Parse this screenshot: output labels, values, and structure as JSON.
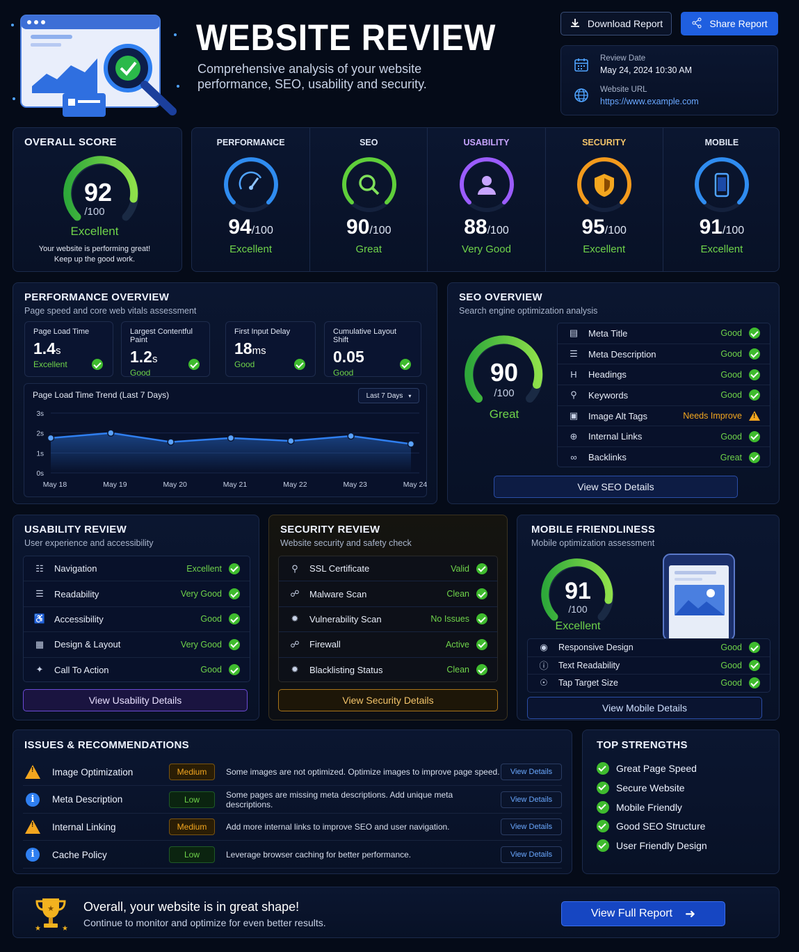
{
  "header": {
    "title": "WEBSITE REVIEW",
    "subtitle_line1": "Comprehensive analysis of your website",
    "subtitle_line2": "performance, SEO, usability and security.",
    "download_label": "Download Report",
    "share_label": "Share Report",
    "review_date_label": "Review Date",
    "review_date": "May 24, 2024 10:30 AM",
    "website_url_label": "Website URL",
    "website_url": "https://www.example.com"
  },
  "overall": {
    "title": "OVERALL SCORE",
    "score": "92",
    "max": "/100",
    "rating": "Excellent",
    "note_line1": "Your website is performing great!",
    "note_line2": "Keep up the good work."
  },
  "categories": [
    {
      "name": "PERFORMANCE",
      "score": "94",
      "max": "/100",
      "rating": "Excellent",
      "color": "#2f8cf0",
      "icon": "speedometer-icon"
    },
    {
      "name": "SEO",
      "score": "90",
      "max": "/100",
      "rating": "Great",
      "color": "#5fcf3a",
      "icon": "magnifier-icon"
    },
    {
      "name": "USABILITY",
      "score": "88",
      "max": "/100",
      "rating": "Very Good",
      "color": "#9b5cff",
      "icon": "user-icon"
    },
    {
      "name": "SECURITY",
      "score": "95",
      "max": "/100",
      "rating": "Excellent",
      "color": "#f39a1c",
      "icon": "shield-icon"
    },
    {
      "name": "MOBILE",
      "score": "91",
      "max": "/100",
      "rating": "Excellent",
      "color": "#2f8cf0",
      "icon": "phone-icon"
    }
  ],
  "performance": {
    "title": "PERFORMANCE OVERVIEW",
    "subtitle": "Page speed and core web vitals assessment",
    "metrics": [
      {
        "label": "Page Load Time",
        "value": "1.4",
        "unit": "s",
        "status": "Excellent"
      },
      {
        "label": "Largest Contentful Paint",
        "value": "1.2",
        "unit": "s",
        "status": "Good"
      },
      {
        "label": "First Input Delay",
        "value": "18",
        "unit": "ms",
        "status": "Good"
      },
      {
        "label": "Cumulative Layout Shift",
        "value": "0.05",
        "unit": "",
        "status": "Good"
      }
    ],
    "trend_title": "Page Load Time Trend (Last 7 Days)",
    "range_select": "Last 7 Days"
  },
  "chart_data": {
    "type": "line",
    "title": "Page Load Time Trend (Last 7 Days)",
    "categories": [
      "May 18",
      "May 19",
      "May 20",
      "May 21",
      "May 22",
      "May 23",
      "May 24"
    ],
    "values": [
      1.75,
      2.0,
      1.55,
      1.75,
      1.6,
      1.85,
      1.45
    ],
    "y_ticks": [
      "0s",
      "1s",
      "2s",
      "3s"
    ],
    "ylim": [
      0,
      3
    ],
    "color": "#2f7ff0"
  },
  "seo": {
    "title": "SEO OVERVIEW",
    "subtitle": "Search engine optimization analysis",
    "score": "90",
    "max": "/100",
    "rating": "Great",
    "items": [
      {
        "label": "Meta Title",
        "status": "Good",
        "icon": "document-icon",
        "warn": false
      },
      {
        "label": "Meta Description",
        "status": "Good",
        "icon": "list-icon",
        "warn": false
      },
      {
        "label": "Headings",
        "status": "Good",
        "icon": "heading-icon",
        "warn": false
      },
      {
        "label": "Keywords",
        "status": "Good",
        "icon": "key-icon",
        "warn": false
      },
      {
        "label": "Image Alt Tags",
        "status": "Needs Improve",
        "icon": "image-icon",
        "warn": true
      },
      {
        "label": "Internal Links",
        "status": "Good",
        "icon": "link-circle-icon",
        "warn": false
      },
      {
        "label": "Backlinks",
        "status": "Great",
        "icon": "link-icon",
        "warn": false
      }
    ],
    "details_label": "View SEO Details"
  },
  "usability": {
    "title": "USABILITY REVIEW",
    "subtitle": "User experience and accessibility",
    "items": [
      {
        "label": "Navigation",
        "status": "Excellent",
        "icon": "navigation-icon"
      },
      {
        "label": "Readability",
        "status": "Very Good",
        "icon": "readability-icon"
      },
      {
        "label": "Accessibility",
        "status": "Good",
        "icon": "accessibility-icon"
      },
      {
        "label": "Design & Layout",
        "status": "Very Good",
        "icon": "layout-icon"
      },
      {
        "label": "Call To Action",
        "status": "Good",
        "icon": "cta-icon"
      }
    ],
    "details_label": "View Usability Details"
  },
  "security": {
    "title": "SECURITY REVIEW",
    "subtitle": "Website security and safety check",
    "items": [
      {
        "label": "SSL Certificate",
        "status": "Valid",
        "icon": "lock-icon"
      },
      {
        "label": "Malware Scan",
        "status": "Clean",
        "icon": "shield-check-icon"
      },
      {
        "label": "Vulnerability Scan",
        "status": "No Issues",
        "icon": "bug-icon"
      },
      {
        "label": "Firewall",
        "status": "Active",
        "icon": "firewall-icon"
      },
      {
        "label": "Blacklisting Status",
        "status": "Clean",
        "icon": "blacklist-icon"
      }
    ],
    "details_label": "View Security Details"
  },
  "mobile": {
    "title": "MOBILE FRIENDLINESS",
    "subtitle": "Mobile optimization assessment",
    "score": "91",
    "max": "/100",
    "rating": "Excellent",
    "items": [
      {
        "label": "Responsive Design",
        "status": "Good",
        "icon": "responsive-icon"
      },
      {
        "label": "Text Readability",
        "status": "Good",
        "icon": "text-icon"
      },
      {
        "label": "Tap Target Size",
        "status": "Good",
        "icon": "tap-icon"
      }
    ],
    "details_label": "View Mobile Details"
  },
  "issues": {
    "title": "ISSUES & RECOMMENDATIONS",
    "items": [
      {
        "name": "Image Optimization",
        "priority": "Medium",
        "desc": "Some images are not optimized. Optimize images to improve page speed.",
        "action": "View Details",
        "icon": "warning-icon"
      },
      {
        "name": "Meta Description",
        "priority": "Low",
        "desc": "Some pages are missing meta descriptions. Add unique meta descriptions.",
        "action": "View Details",
        "icon": "info-icon"
      },
      {
        "name": "Internal Linking",
        "priority": "Medium",
        "desc": "Add more internal links to improve SEO and user navigation.",
        "action": "View Details",
        "icon": "warning-icon"
      },
      {
        "name": "Cache Policy",
        "priority": "Low",
        "desc": "Leverage browser caching for better performance.",
        "action": "View Details",
        "icon": "info-icon"
      }
    ]
  },
  "strengths": {
    "title": "TOP STRENGTHS",
    "items": [
      "Great Page Speed",
      "Secure Website",
      "Mobile Friendly",
      "Good SEO Structure",
      "User Friendly Design"
    ]
  },
  "footer": {
    "headline": "Overall, your website is in great shape!",
    "sub": "Continue to monitor and optimize for even better results.",
    "button": "View Full Report"
  }
}
